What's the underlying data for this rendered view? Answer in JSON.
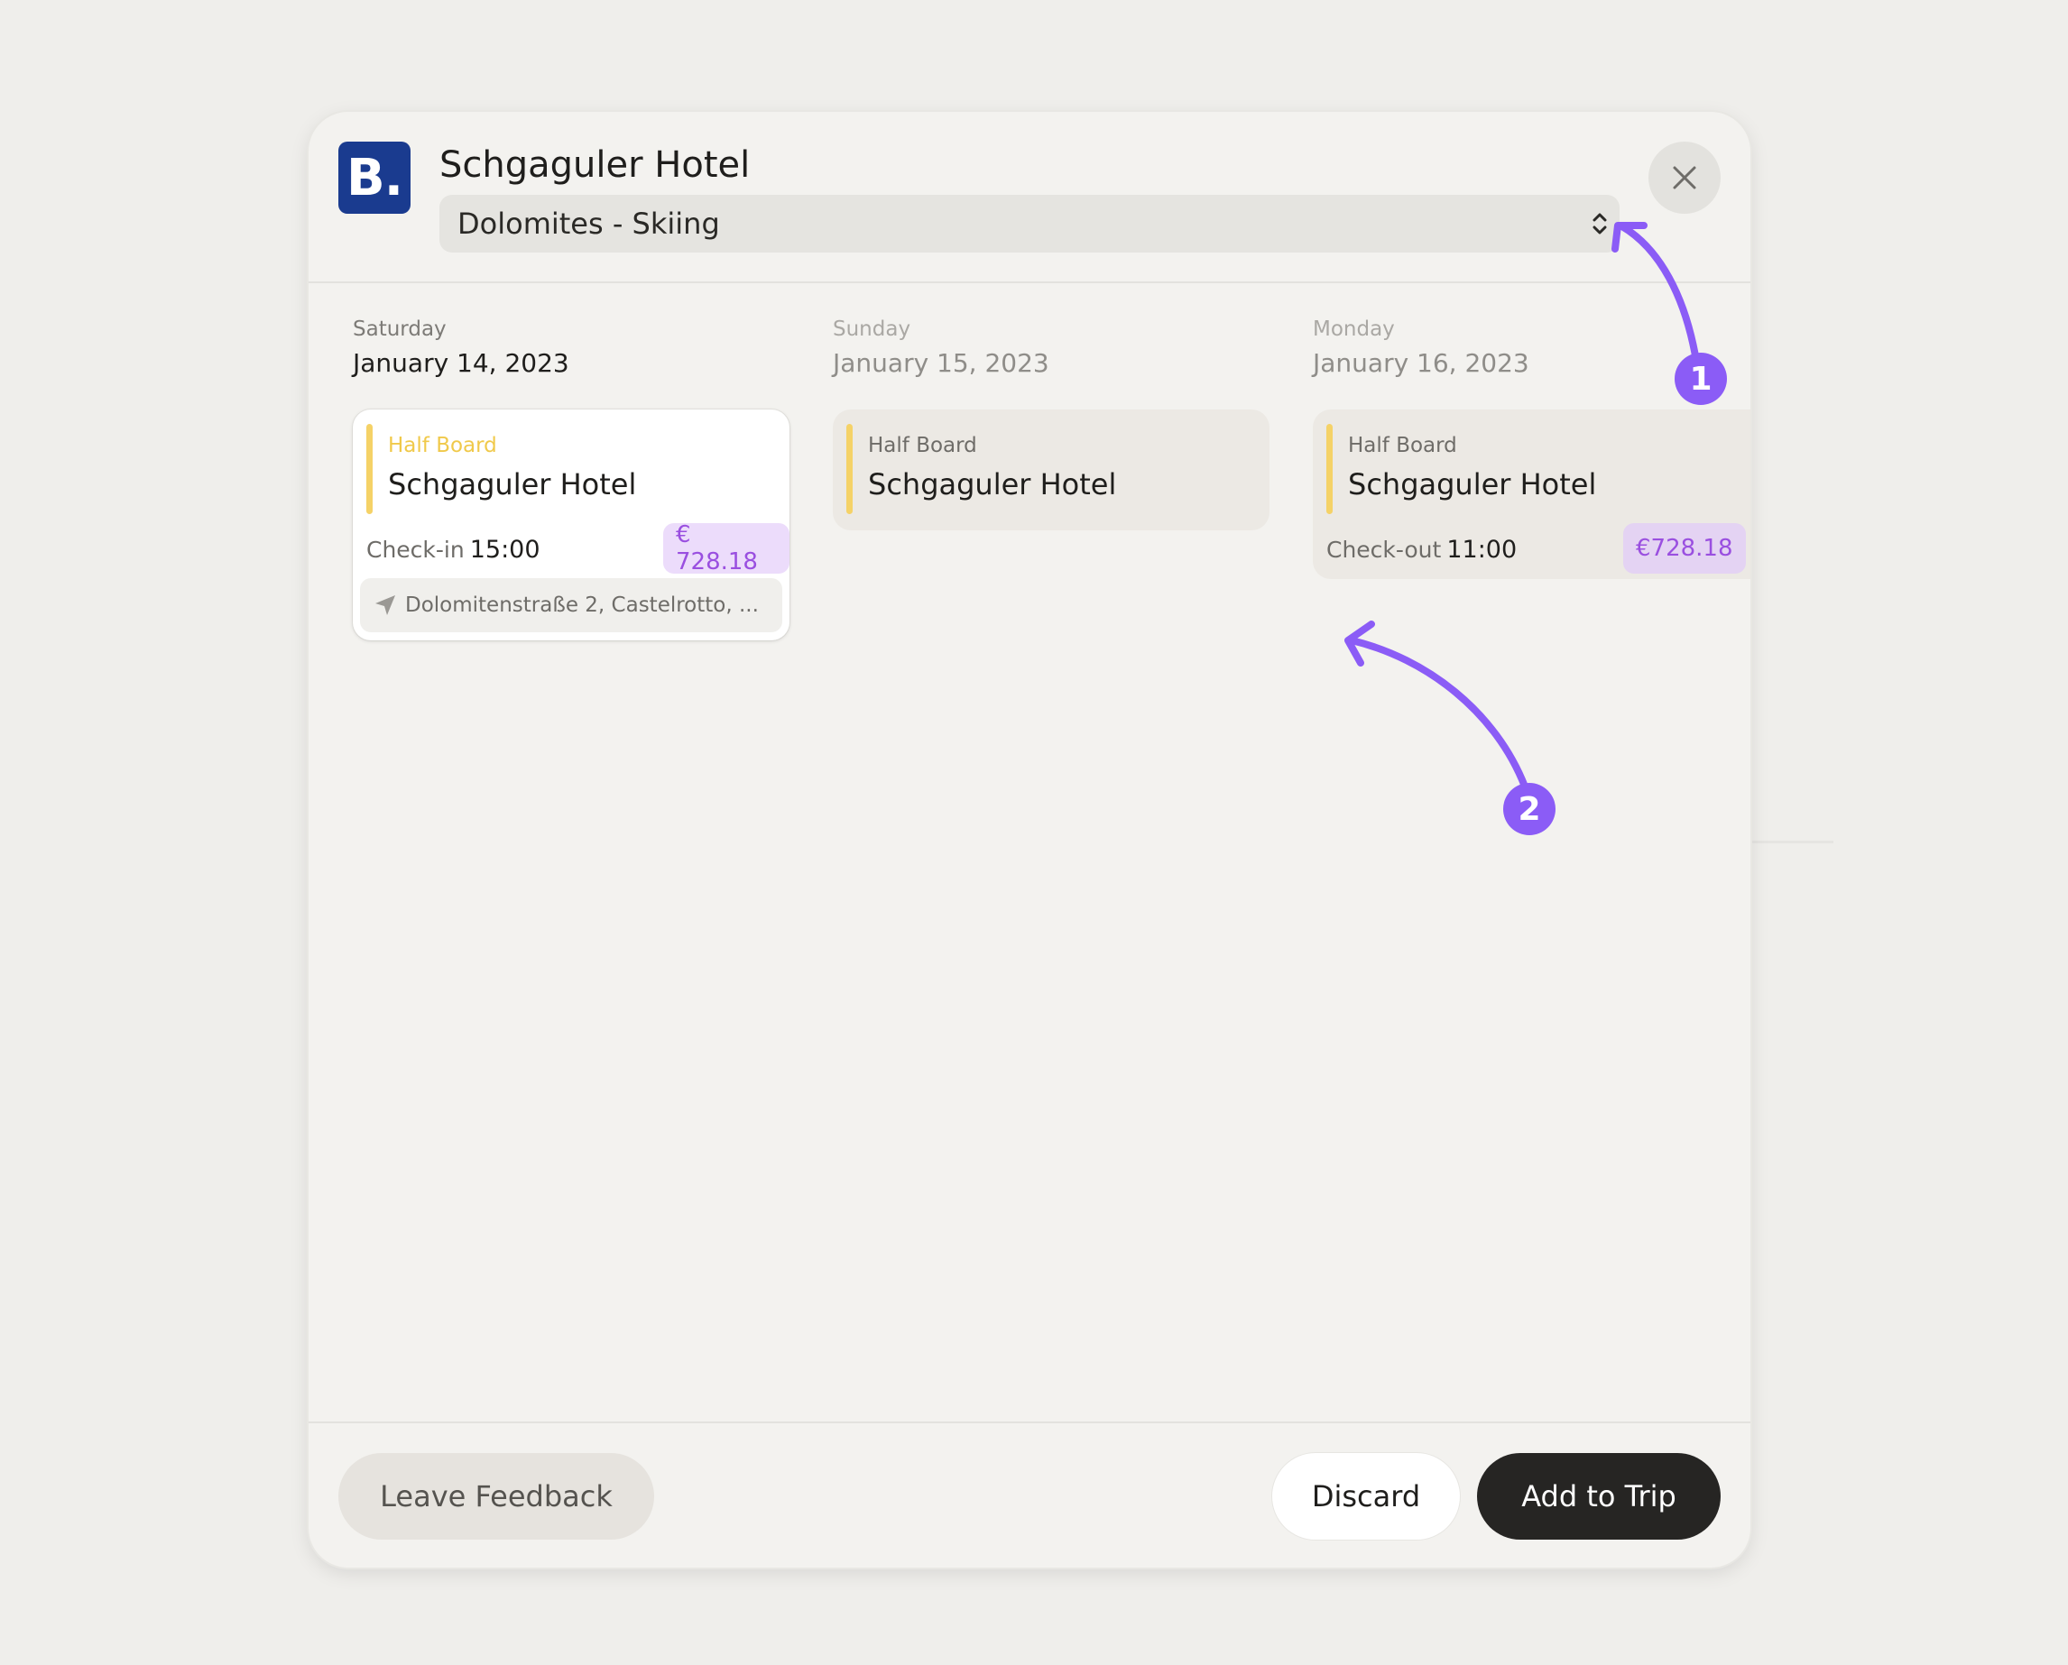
{
  "modal": {
    "title": "Schgaguler Hotel",
    "logo_text": "B.",
    "logo_color": "#1a3b8f",
    "trip_select": {
      "value": "Dolomites - Skiing"
    }
  },
  "days": [
    {
      "weekday": "Saturday",
      "date": "January 14, 2023",
      "card": {
        "board": "Half Board",
        "hotel": "Schgaguler Hotel",
        "time_label": "Check-in",
        "time": "15:00",
        "price": "€ 728.18",
        "address": "Dolomitenstraße 2, Castelrotto, ..."
      }
    },
    {
      "weekday": "Sunday",
      "date": "January 15, 2023",
      "card": {
        "board": "Half Board",
        "hotel": "Schgaguler Hotel"
      }
    },
    {
      "weekday": "Monday",
      "date": "January 16, 2023",
      "card": {
        "board": "Half Board",
        "hotel": "Schgaguler Hotel",
        "time_label": "Check-out",
        "time": "11:00",
        "price": "€728.18"
      }
    }
  ],
  "footer": {
    "feedback_label": "Leave Feedback",
    "discard_label": "Discard",
    "add_label": "Add to Trip"
  },
  "annotations": {
    "badge_1": "1",
    "badge_2": "2",
    "color": "#8b5cf6"
  },
  "colors": {
    "accent_yellow": "#f5d267",
    "price_purple": "#9a4fe0",
    "primary_button": "#262523"
  }
}
